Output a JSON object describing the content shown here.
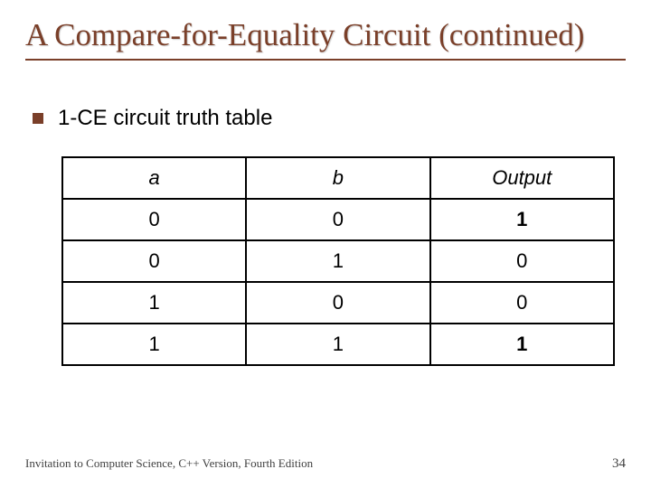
{
  "title": "A Compare-for-Equality Circuit (continued)",
  "bullet": "1-CE circuit truth table",
  "chart_data": {
    "type": "table",
    "headers": [
      "a",
      "b",
      "Output"
    ],
    "rows": [
      [
        "0",
        "0",
        "1"
      ],
      [
        "0",
        "1",
        "0"
      ],
      [
        "1",
        "0",
        "0"
      ],
      [
        "1",
        "1",
        "1"
      ]
    ]
  },
  "footer": {
    "text": "Invitation to Computer Science, C++ Version, Fourth Edition",
    "page": "34"
  }
}
